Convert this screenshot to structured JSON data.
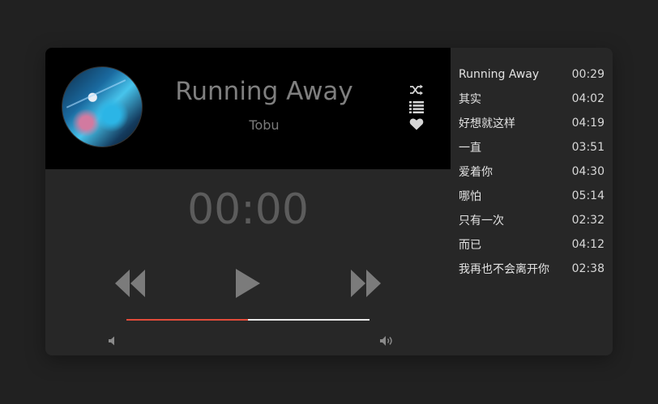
{
  "now_playing": {
    "title": "Running Away",
    "artist": "Tobu",
    "time": "00:00",
    "progress": 0.5,
    "accent_color": "#e14b3a"
  },
  "icons": {
    "shuffle": "shuffle-icon",
    "playlist": "list-icon",
    "favorite": "heart-icon",
    "previous": "rewind-icon",
    "play": "play-icon",
    "next": "fast-forward-icon",
    "volume_low": "volume-low-icon",
    "volume_high": "volume-high-icon"
  },
  "playlist": [
    {
      "title": "Running Away",
      "duration": "00:29"
    },
    {
      "title": "其实",
      "duration": "04:02"
    },
    {
      "title": "好想就这样",
      "duration": "04:19"
    },
    {
      "title": "一直",
      "duration": "03:51"
    },
    {
      "title": "爱着你",
      "duration": "04:30"
    },
    {
      "title": "哪怕",
      "duration": "05:14"
    },
    {
      "title": "只有一次",
      "duration": "02:32"
    },
    {
      "title": "而已",
      "duration": "04:12"
    },
    {
      "title": "我再也不会离开你",
      "duration": "02:38"
    }
  ]
}
